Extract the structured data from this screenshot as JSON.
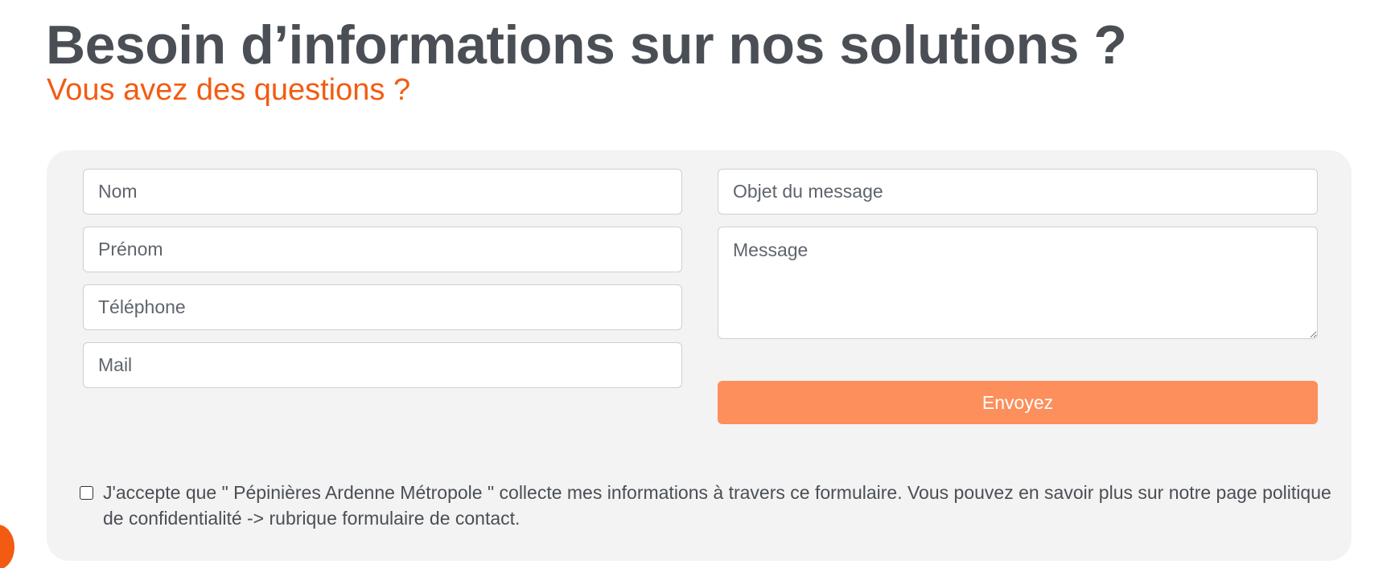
{
  "header": {
    "title": "Besoin d’informations sur nos solutions ?",
    "subtitle": "Vous avez des questions ?"
  },
  "form": {
    "fields": {
      "nom": {
        "placeholder": "Nom",
        "value": ""
      },
      "prenom": {
        "placeholder": "Prénom",
        "value": ""
      },
      "telephone": {
        "placeholder": "Téléphone",
        "value": ""
      },
      "mail": {
        "placeholder": "Mail",
        "value": ""
      },
      "objet": {
        "placeholder": "Objet du message",
        "value": ""
      },
      "message": {
        "placeholder": "Message",
        "value": ""
      }
    },
    "submit_label": "Envoyez",
    "consent": {
      "checked": false,
      "text": "J'accepte que \" Pépinières Ardenne Métropole \" collecte mes informations à travers ce formulaire. Vous pouvez en savoir plus sur notre page politique de confidentialité -> rubrique formulaire de contact."
    }
  },
  "colors": {
    "title": "#4a4f55",
    "accent": "#f25c12",
    "button": "#fc8f5b",
    "card_background": "#f3f3f3"
  },
  "icons": {
    "chat": "chat-bubble-icon"
  }
}
